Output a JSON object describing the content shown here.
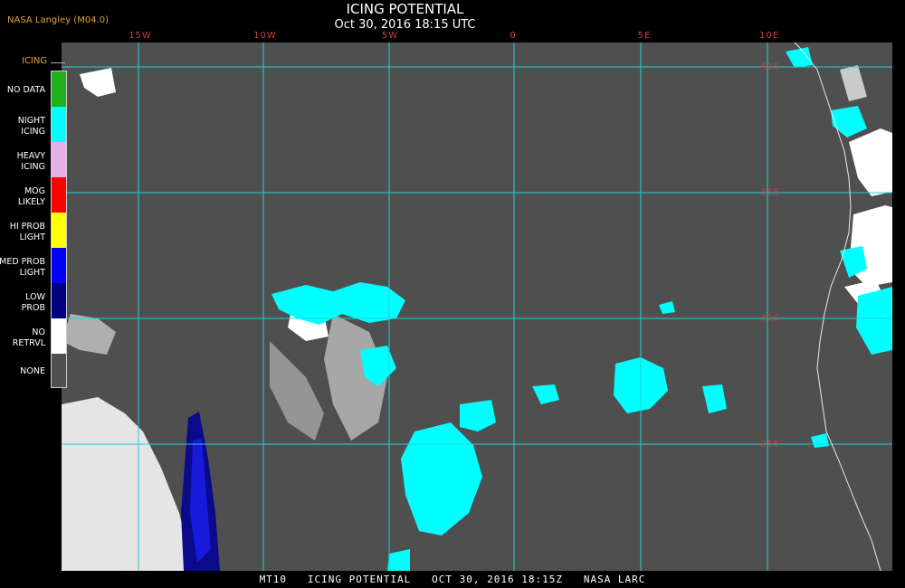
{
  "header": {
    "org": "NASA Langley (M04.0)",
    "title": "ICING POTENTIAL",
    "datetime": "Oct 30, 2016 18:15 UTC"
  },
  "longitude_labels": [
    "15W",
    "10W",
    "5W",
    "0",
    "5E",
    "10E"
  ],
  "latitude_labels": [
    "40S",
    "35S",
    "30S",
    "25S"
  ],
  "legend": {
    "title": "ICING",
    "items": [
      {
        "label": "NO DATA",
        "color": "#1faf1f"
      },
      {
        "label": "NIGHT\nICING",
        "color": "#00ffff"
      },
      {
        "label": "HEAVY\nICING",
        "color": "#e6b0e6"
      },
      {
        "label": "MOG\nLIKELY",
        "color": "#ff0000"
      },
      {
        "label": "HI PROB\nLIGHT",
        "color": "#ffff00"
      },
      {
        "label": "MED PROB\nLIGHT",
        "color": "#0000ff"
      },
      {
        "label": "LOW\nPROB",
        "color": "#000080"
      },
      {
        "label": "NO\nRETRVL",
        "color": "#ffffff"
      },
      {
        "label": "NONE",
        "color": "#4f4f4f"
      }
    ]
  },
  "colors": {
    "background": "#4f4f4f",
    "grid": "#22d0d0",
    "grid_labels": "#c84040",
    "coastline": "#e8e8e8"
  },
  "footer": "MT10   ICING POTENTIAL   OCT 30, 2016 18:15Z   NASA LARC"
}
